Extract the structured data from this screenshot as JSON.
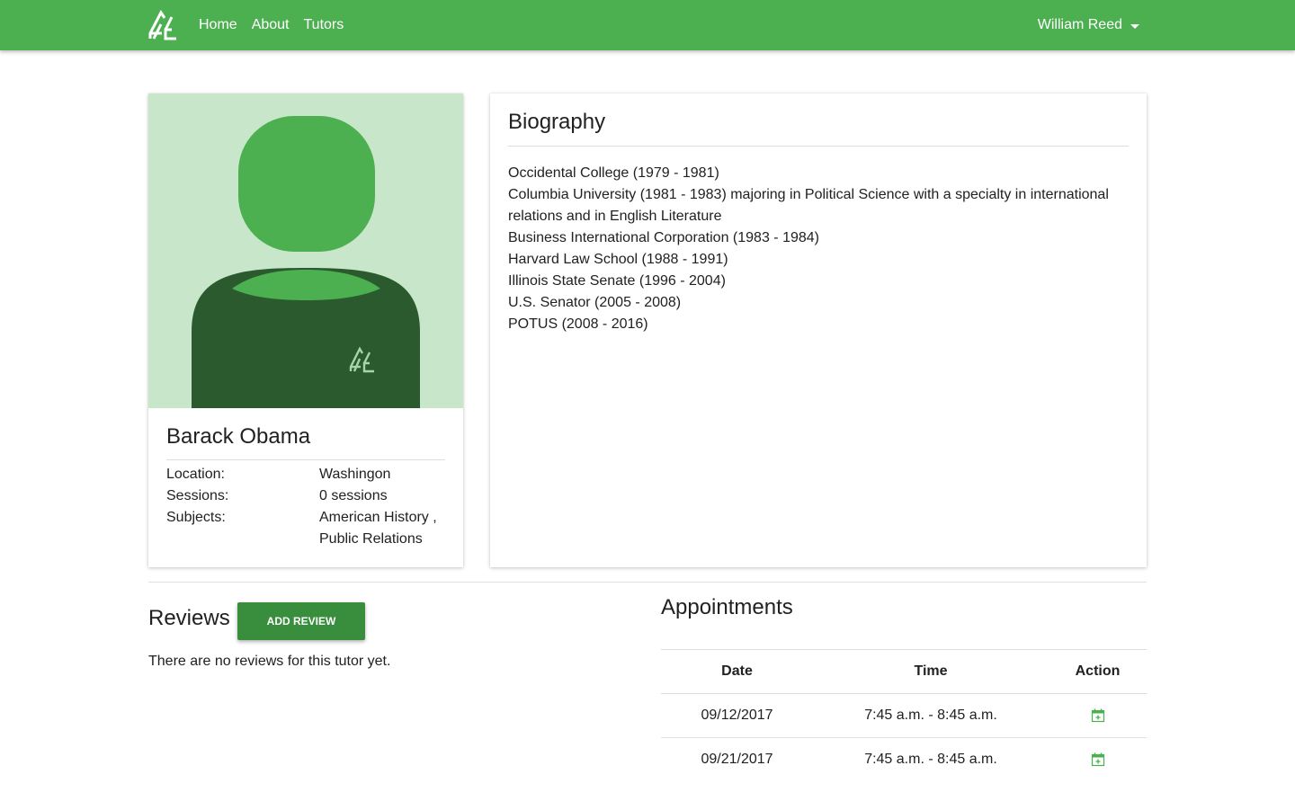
{
  "navbar": {
    "logo_icon": "tree-logo-icon",
    "links": [
      {
        "label": "Home"
      },
      {
        "label": "About"
      },
      {
        "label": "Tutors"
      }
    ],
    "user_name": "William Reed"
  },
  "profile": {
    "avatar_icon": "person-avatar-icon",
    "name": "Barack Obama",
    "fields": [
      {
        "label": "Location:",
        "value": "Washingon"
      },
      {
        "label": "Sessions:",
        "value": "0 sessions"
      },
      {
        "label": "Subjects:",
        "value": "American History , Public Relations"
      }
    ]
  },
  "biography": {
    "title": "Biography",
    "lines": [
      "Occidental College (1979 - 1981)",
      "Columbia University (1981 - 1983) majoring in Political Science with a specialty in international relations and in English Literature",
      "Business International Corporation (1983 - 1984)",
      "Harvard Law School (1988 - 1991)",
      "Illinois State Senate (1996 - 2004)",
      "U.S. Senator (2005 - 2008)",
      "POTUS (2008 - 2016)"
    ]
  },
  "reviews": {
    "title": "Reviews",
    "add_button": "Add Review",
    "empty_text": "There are no reviews for this tutor yet."
  },
  "appointments": {
    "title": "Appointments",
    "columns": [
      "Date",
      "Time",
      "Action"
    ],
    "rows": [
      {
        "date": "09/12/2017",
        "time": "7:45 a.m. - 8:45 a.m.",
        "action_icon": "calendar-add-icon"
      },
      {
        "date": "09/21/2017",
        "time": "7:45 a.m. - 8:45 a.m.",
        "action_icon": "calendar-add-icon"
      }
    ]
  },
  "colors": {
    "primary": "#4caf50",
    "primary_dark": "#388e3c",
    "avatar_bg": "#c8e6c9",
    "avatar_body": "#2a5a2e"
  }
}
